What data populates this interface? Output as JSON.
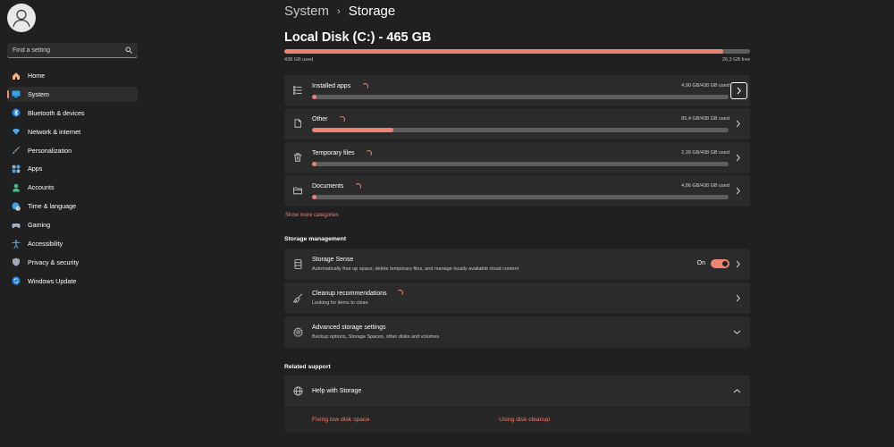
{
  "sidebar": {
    "search": {
      "placeholder": "Find a setting"
    },
    "items": [
      {
        "label": "Home",
        "icon": "home-icon",
        "active": false
      },
      {
        "label": "System",
        "icon": "system-icon",
        "active": true
      },
      {
        "label": "Bluetooth & devices",
        "icon": "bluetooth-icon",
        "active": false
      },
      {
        "label": "Network & internet",
        "icon": "network-icon",
        "active": false
      },
      {
        "label": "Personalization",
        "icon": "brush-icon",
        "active": false
      },
      {
        "label": "Apps",
        "icon": "apps-icon",
        "active": false
      },
      {
        "label": "Accounts",
        "icon": "accounts-icon",
        "active": false
      },
      {
        "label": "Time & language",
        "icon": "globe-clock-icon",
        "active": false
      },
      {
        "label": "Gaming",
        "icon": "gamepad-icon",
        "active": false
      },
      {
        "label": "Accessibility",
        "icon": "accessibility-icon",
        "active": false
      },
      {
        "label": "Privacy & security",
        "icon": "shield-icon",
        "active": false
      },
      {
        "label": "Windows Update",
        "icon": "update-icon",
        "active": false
      }
    ]
  },
  "header": {
    "breadcrumb_parent": "System",
    "breadcrumb_separator": "›",
    "breadcrumb_current": "Storage"
  },
  "disk": {
    "title": "Local Disk (C:) - 465 GB",
    "used_label": "438 GB used",
    "free_label": "26,3 GB free",
    "used_fraction": 0.942
  },
  "categories": [
    {
      "label": "Installed apps",
      "size": "4,90 GB/438 GB used",
      "fraction": 0.011,
      "icon": "apps-list-icon",
      "loading": true
    },
    {
      "label": "Other",
      "size": "85,4 GB/438 GB used",
      "fraction": 0.195,
      "icon": "other-icon",
      "loading": true
    },
    {
      "label": "Temporary files",
      "size": "2,39 GB/438 GB used",
      "fraction": 0.006,
      "icon": "trash-icon",
      "loading": true
    },
    {
      "label": "Documents",
      "size": "4,86 GB/438 GB used",
      "fraction": 0.011,
      "icon": "folder-icon",
      "loading": true
    }
  ],
  "show_more": "Show more categories",
  "storage_management": {
    "title": "Storage management",
    "storage_sense": {
      "label": "Storage Sense",
      "description": "Automatically free up space, delete temporary files, and manage locally available cloud content",
      "toggle_label": "On",
      "enabled": true
    },
    "cleanup": {
      "label": "Cleanup recommendations",
      "description": "Looking for items to clean"
    },
    "advanced": {
      "label": "Advanced storage settings",
      "description": "Backup options, Storage Spaces, other disks and volumes"
    }
  },
  "related_support": {
    "title": "Related support",
    "help_label": "Help with Storage",
    "links": [
      "Fixing low disk space",
      "Using disk cleanup"
    ]
  },
  "colors": {
    "accent": "#ee8371",
    "background": "#202020",
    "card": "#2b2b2b"
  }
}
